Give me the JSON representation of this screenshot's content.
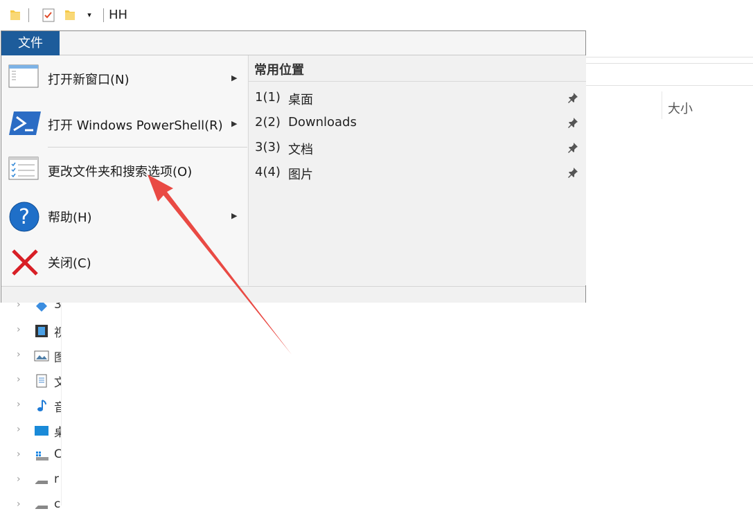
{
  "titlebar": {
    "title": "HH",
    "icons": [
      "folder-icon",
      "properties-icon",
      "new-folder-icon",
      "customize-dropdown-icon"
    ]
  },
  "background": {
    "column_size_label": "大小",
    "tree_items": [
      {
        "icon": "3d-objects-icon",
        "text": "3"
      },
      {
        "icon": "videos-icon",
        "text": "视"
      },
      {
        "icon": "pictures-icon",
        "text": "图"
      },
      {
        "icon": "documents-icon",
        "text": "文"
      },
      {
        "icon": "music-icon",
        "text": "音"
      },
      {
        "icon": "desktop-icon",
        "text": "桌"
      },
      {
        "icon": "windows-drive-icon",
        "text": "C"
      },
      {
        "icon": "drive-icon",
        "text": "r"
      },
      {
        "icon": "drive-icon",
        "text": "c"
      }
    ]
  },
  "file_menu": {
    "tab_label": "文件",
    "items": [
      {
        "label": "打开新窗口(N)",
        "icon": "new-window-icon",
        "has_submenu": true
      },
      {
        "label": "打开 Windows PowerShell(R)",
        "icon": "powershell-icon",
        "has_submenu": true
      },
      {
        "label": "更改文件夹和搜索选项(O)",
        "icon": "folder-options-icon",
        "has_submenu": false
      },
      {
        "label": "帮助(H)",
        "icon": "help-icon",
        "has_submenu": true
      },
      {
        "label": "关闭(C)",
        "icon": "close-icon",
        "has_submenu": false
      }
    ],
    "frequent_places": {
      "title": "常用位置",
      "items": [
        {
          "num": "1(1)",
          "name": "桌面"
        },
        {
          "num": "2(2)",
          "name": "Downloads"
        },
        {
          "num": "3(3)",
          "name": "文档"
        },
        {
          "num": "4(4)",
          "name": "图片"
        }
      ]
    }
  },
  "colors": {
    "file_tab": "#1d5c9b",
    "annotation_arrow": "#e8403a"
  }
}
